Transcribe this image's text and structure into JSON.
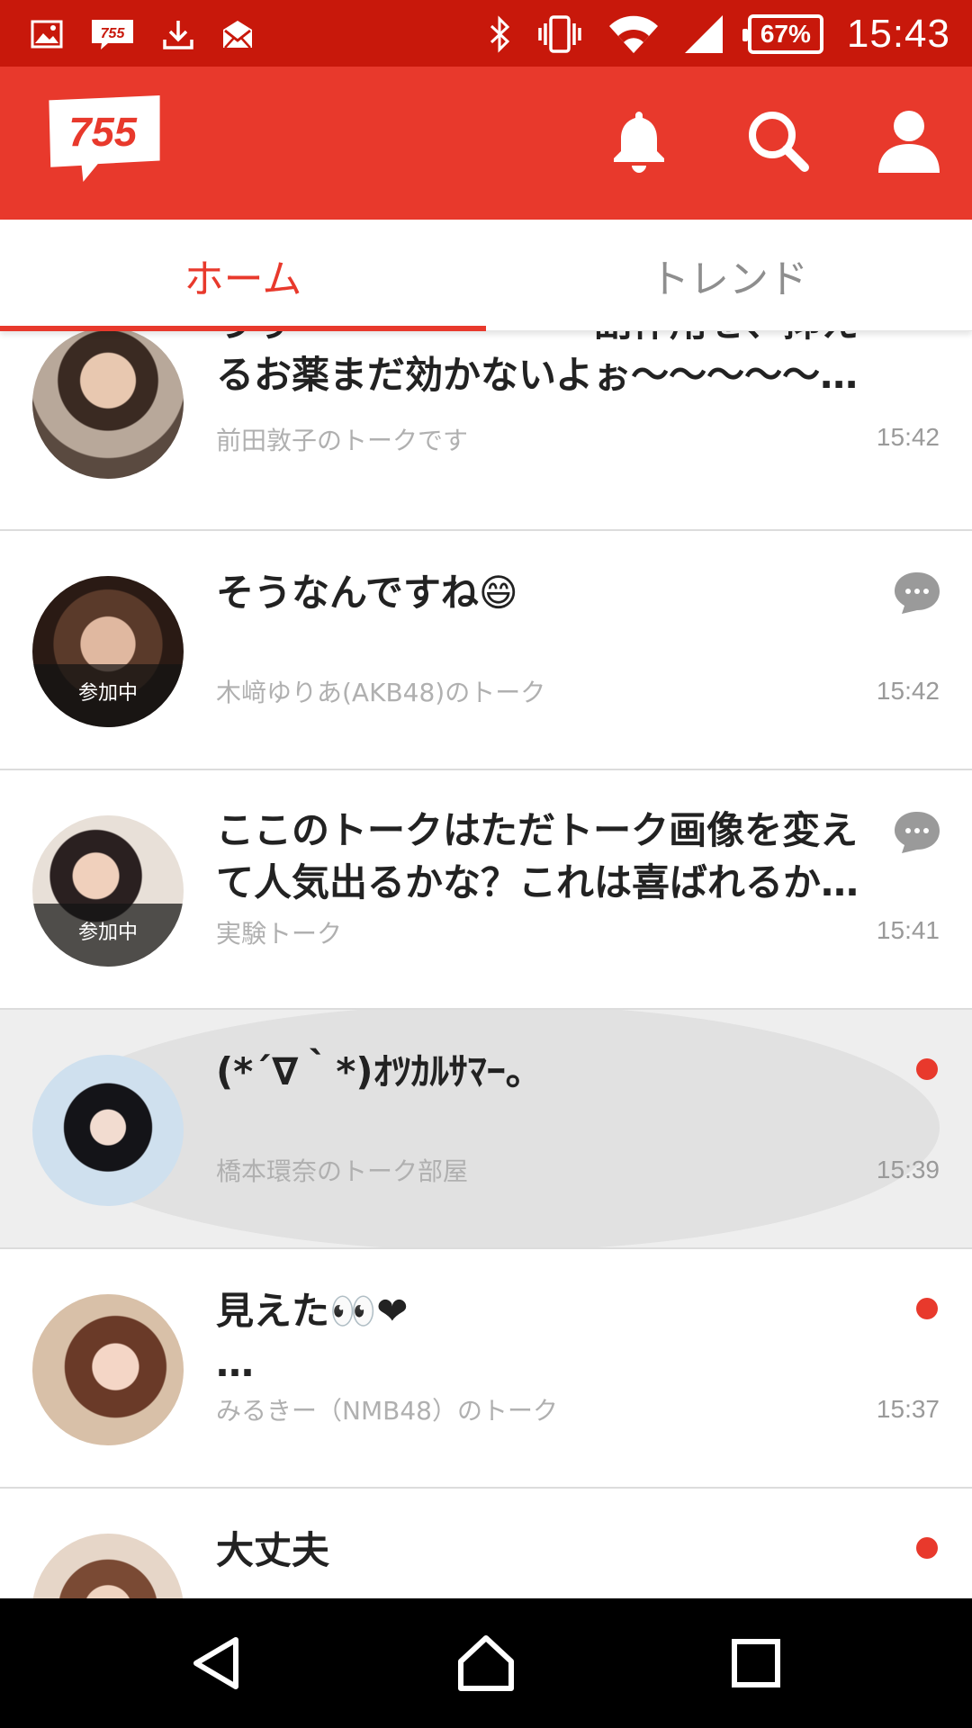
{
  "status_bar": {
    "time": "15:43",
    "battery": "67%",
    "left_icons": [
      "gallery-icon",
      "755-icon",
      "download-icon",
      "mail-icon"
    ],
    "right_icons": [
      "bluetooth-icon",
      "vibrate-icon",
      "wifi-icon",
      "signal-icon"
    ]
  },
  "app_bar": {
    "logo_text": "755",
    "accent_color": "#e8392c",
    "icons": [
      "bell-icon",
      "search-icon",
      "person-icon"
    ]
  },
  "tabs": [
    {
      "label": "ホーム",
      "active": true
    },
    {
      "label": "トレンド",
      "active": false
    }
  ],
  "talks": [
    {
      "line1": "うぅ〜〜〜〜〜〜〜〜副作用を、抑え",
      "line2": "るお薬まだ効かないよぉ〜〜〜〜〜…",
      "subtitle": "前田敦子のトークです",
      "time": "15:42",
      "indicator": "unread-dot",
      "badge": ""
    },
    {
      "line1": "そうなんですね😄",
      "line2": "",
      "subtitle": "木﨑ゆりあ(AKB48)のトーク",
      "time": "15:42",
      "indicator": "chat-bubble",
      "badge": "参加中"
    },
    {
      "line1": "ここのトークはただトーク画像を変え",
      "line2": "て人気出るかな？これは喜ばれるか…",
      "subtitle": "実験トーク",
      "time": "15:41",
      "indicator": "chat-bubble",
      "badge": "参加中"
    },
    {
      "line1": "(*´∇｀*)ｵﾂｶﾙｻﾏｰ。",
      "line2": "",
      "subtitle": "橋本環奈のトーク部屋",
      "time": "15:39",
      "indicator": "unread-dot",
      "badge": ""
    },
    {
      "line1": "見えた👀❤",
      "line2": "…",
      "subtitle": "みるきー（NMB48）のトーク",
      "time": "15:37",
      "indicator": "unread-dot",
      "badge": ""
    },
    {
      "line1": "大丈夫",
      "line2": "",
      "subtitle": "",
      "time": "",
      "indicator": "unread-dot",
      "badge": ""
    }
  ],
  "nav_bar": {
    "icons": [
      "back-icon",
      "home-icon",
      "recent-apps-icon"
    ]
  }
}
